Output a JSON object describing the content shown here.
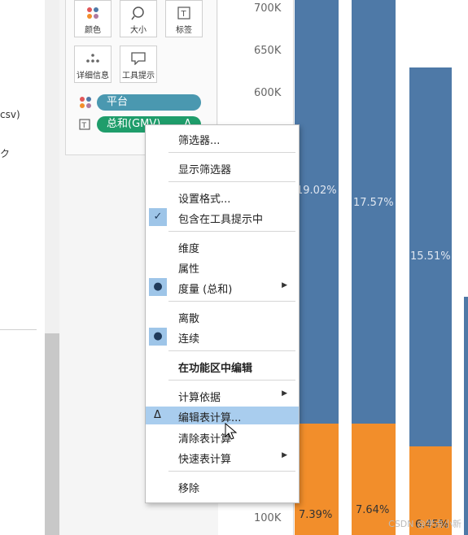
{
  "left_fragments": [
    "csv)",
    "ク"
  ],
  "marks": {
    "buttons": [
      {
        "label": "颜色",
        "icon": "color-dots-icon"
      },
      {
        "label": "大小",
        "icon": "size-icon"
      },
      {
        "label": "标签",
        "icon": "label-icon"
      },
      {
        "label": "详细信息",
        "icon": "detail-icon"
      },
      {
        "label": "工具提示",
        "icon": "tooltip-icon"
      }
    ],
    "pills": [
      {
        "label": "平台",
        "icon": "color-dots-icon",
        "color": "#4a98b0"
      },
      {
        "label": "总和(GMV)",
        "icon": "label-icon",
        "color": "#1f9d6b",
        "suffix": "Δ"
      }
    ]
  },
  "chart_data": {
    "type": "bar",
    "yticks": [
      "700K",
      "650K",
      "600K",
      "100K"
    ],
    "bars": [
      {
        "blue_pct_label": "19.02%",
        "orange_pct_label": "7.39%"
      },
      {
        "blue_pct_label": "17.57%",
        "orange_pct_label": "7.64%"
      },
      {
        "blue_pct_label": "15.51%",
        "orange_pct_label": "6.45%"
      }
    ],
    "colors": {
      "blue": "#4e79a7",
      "orange": "#f28e2b"
    }
  },
  "context_menu": {
    "items": [
      {
        "label": "筛选器..."
      },
      {
        "label": "显示筛选器"
      },
      {
        "label": "设置格式..."
      },
      {
        "label": "包含在工具提示中",
        "mark": "✓"
      },
      {
        "label": "维度"
      },
      {
        "label": "属性"
      },
      {
        "label": "度量 (总和)",
        "mark": "●",
        "submenu": "▶"
      },
      {
        "label": "离散"
      },
      {
        "label": "连续",
        "mark": "●"
      },
      {
        "label": "在功能区中编辑"
      },
      {
        "label": "计算依据",
        "submenu": "▶"
      },
      {
        "label": "编辑表计算...",
        "mark": "Δ",
        "highlighted": true
      },
      {
        "label": "清除表计算"
      },
      {
        "label": "快速表计算",
        "submenu": "▶"
      },
      {
        "label": "移除"
      }
    ]
  },
  "watermark": "CSDN @学点小新"
}
